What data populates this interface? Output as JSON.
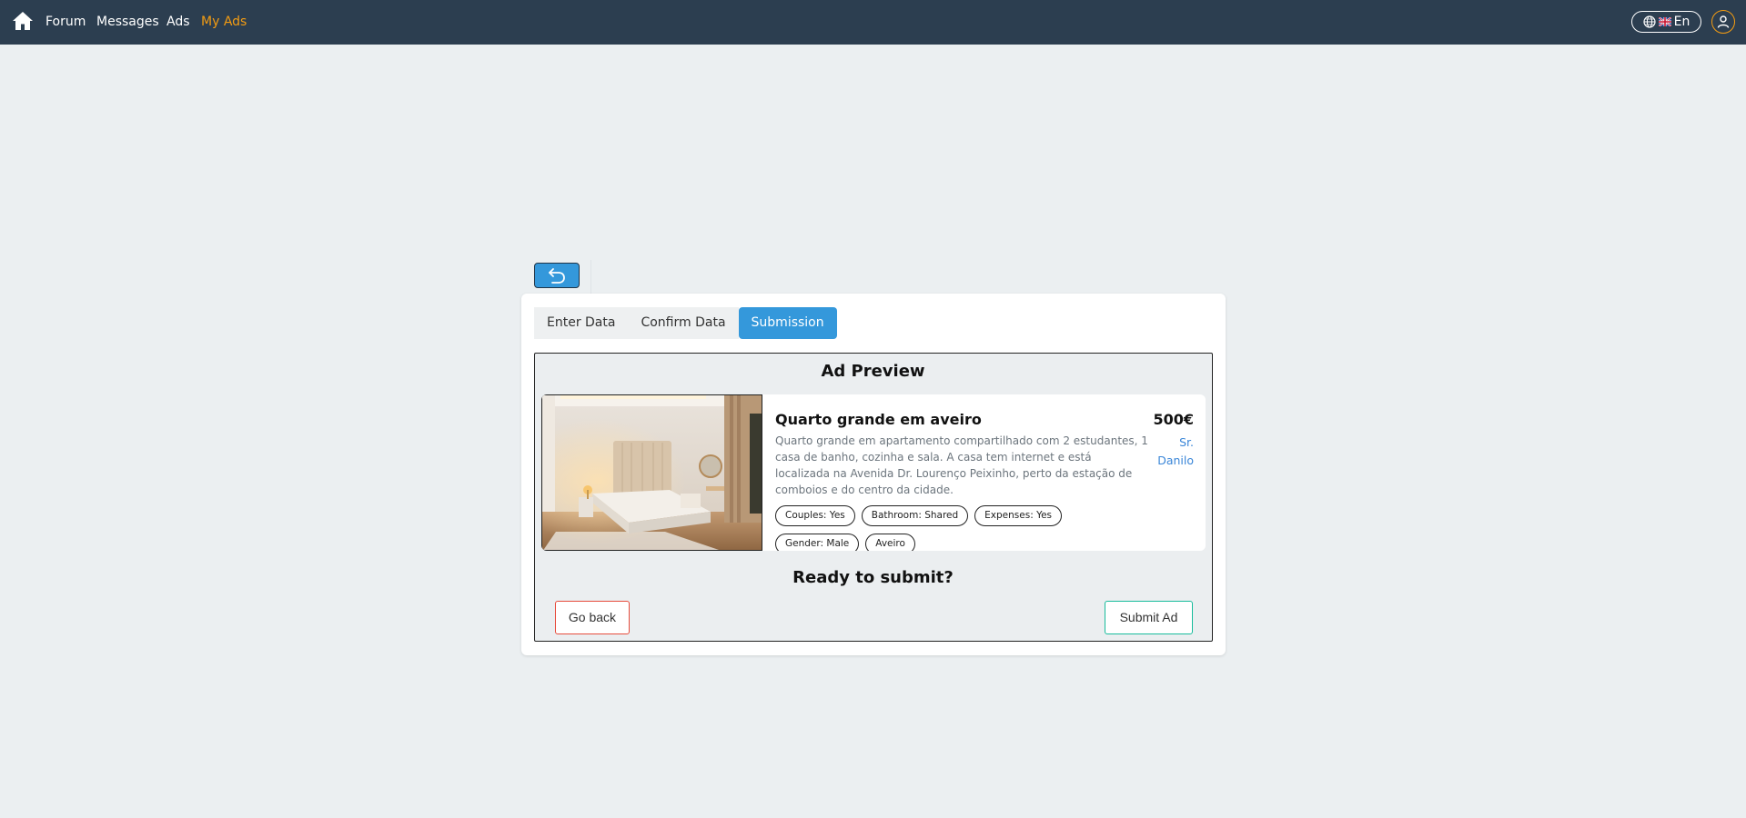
{
  "nav": {
    "home_icon": "home-icon",
    "links": [
      {
        "label": "Forum"
      },
      {
        "label": "Messages"
      },
      {
        "label": "Ads"
      },
      {
        "label": "My Ads"
      }
    ],
    "active_color": "#f39c12",
    "language": {
      "label": "En",
      "icons": [
        "globe-icon",
        "uk-flag-icon"
      ]
    },
    "user_icon": "user-icon"
  },
  "back_button": {
    "icon": "undo-arrow-icon",
    "color": "#3498db"
  },
  "steps": [
    {
      "label": "Enter Data"
    },
    {
      "label": "Confirm Data"
    },
    {
      "label": "Submission"
    }
  ],
  "preview": {
    "title": "Ad Preview",
    "ad": {
      "image": "bedroom-photo",
      "title": "Quarto grande em aveiro",
      "description": "Quarto grande em apartamento compartilhado com 2 estudantes, 1 casa de banho, cozinha e sala. A casa tem internet e está localizada na Avenida Dr. Lourenço Peixinho, perto da estação de comboios e do centro da cidade.",
      "price": "500€",
      "owner": "Sr. Danilo",
      "tags": [
        "Couples: Yes",
        "Bathroom: Shared",
        "Expenses: Yes",
        "Gender: Male",
        "Aveiro"
      ]
    },
    "question": "Ready to submit?",
    "go_back_label": "Go back",
    "submit_label": "Submit Ad"
  },
  "colors": {
    "navbar": "#2c3e50",
    "primary": "#3498db",
    "danger": "#e74c3c",
    "success": "#18bc9c",
    "background": "#ebeff1"
  }
}
